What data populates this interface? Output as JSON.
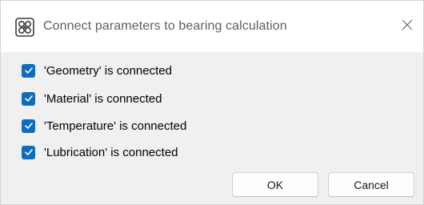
{
  "window": {
    "title": "Connect parameters to bearing calculation",
    "icon": "bearing-app-icon",
    "close_icon": "close-icon"
  },
  "checkboxes": [
    {
      "label": "'Geometry' is connected",
      "checked": true
    },
    {
      "label": "'Material' is connected",
      "checked": true
    },
    {
      "label": "'Temperature' is connected",
      "checked": true
    },
    {
      "label": "'Lubrication' is connected",
      "checked": true
    }
  ],
  "buttons": {
    "ok_label": "OK",
    "cancel_label": "Cancel"
  },
  "colors": {
    "accent": "#0f6cbd",
    "dialog_background": "#f0f0f0",
    "title_text": "#5f5f5f"
  }
}
